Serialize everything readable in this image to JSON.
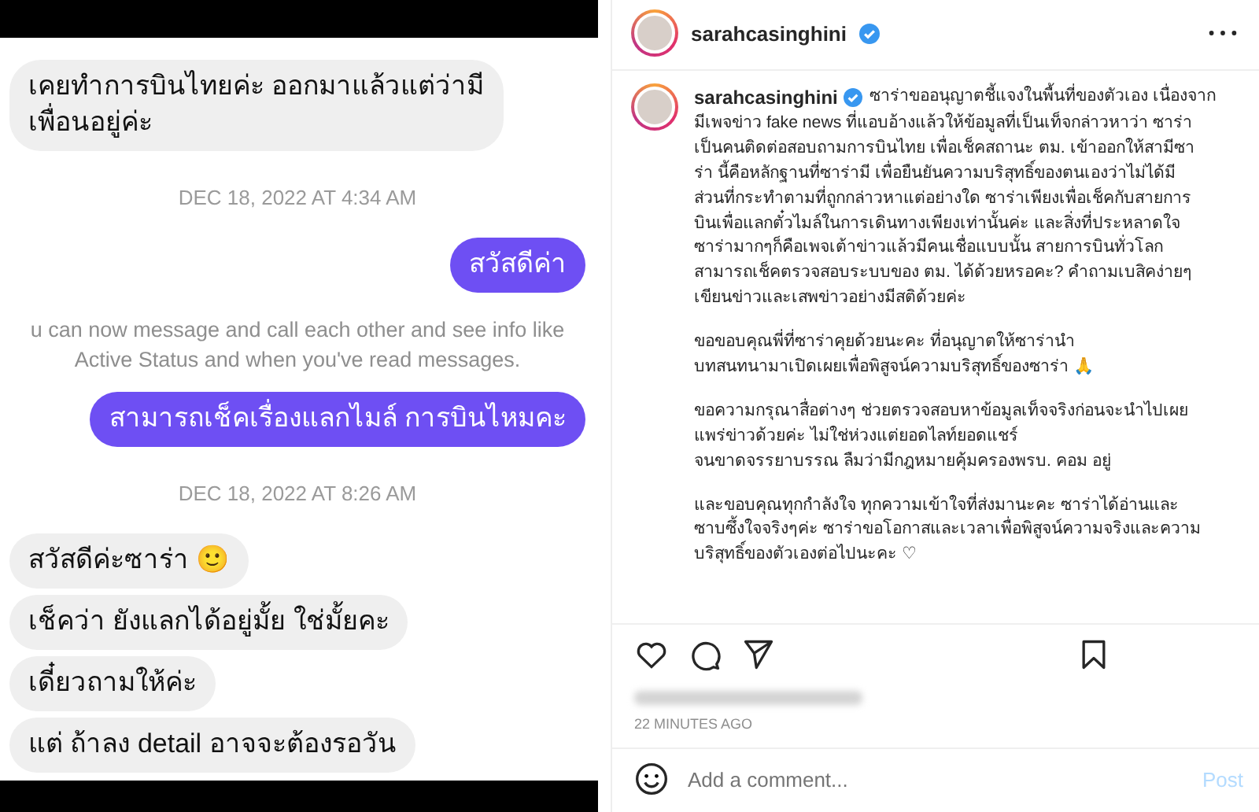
{
  "chat": {
    "items": [
      {
        "kind": "received",
        "text": "เคยทำการบินไทยค่ะ ออกมาแล้วแต่ว่ามี\nเพื่อนอยู่ค่ะ"
      },
      {
        "kind": "date",
        "text": "DEC 18, 2022 AT 4:34 AM"
      },
      {
        "kind": "sent",
        "text": "สวัสดีค่า"
      },
      {
        "kind": "notice",
        "text": "u can now message and call each other and see info like\nActive Status and when you've read messages."
      },
      {
        "kind": "sent",
        "text": "สามารถเช็คเรื่องแลกไมล์ การบินไหมคะ"
      },
      {
        "kind": "date",
        "text": "DEC 18, 2022 AT 8:26 AM"
      },
      {
        "kind": "received",
        "text": "สวัสดีค่ะซาร่า 🙂"
      },
      {
        "kind": "received",
        "text": "เช็คว่า ยังแลกได้อยู่มั้ย ใช่มั้ยคะ"
      },
      {
        "kind": "received",
        "text": "เดี๋ยวถามให้ค่ะ"
      },
      {
        "kind": "received",
        "text": "แต่ ถ้าลง detail อาจจะต้องรอวัน"
      }
    ]
  },
  "post": {
    "username": "sarahcasinghini",
    "caption": {
      "username": "sarahcasinghini",
      "intro": "ซาร่าขออนุญาตชี้แจงในพื้นที่ของตัวเอง เนื่องจาก",
      "paragraphs": [
        "มีเพจข่าว fake news ที่แอบอ้างแล้วให้ข้อมูลที่เป็นเท็จกล่าวหาว่า ซาร่า\nเป็นคนติดต่อสอบถามการบินไทย เพื่อเช็คสถานะ ตม. เข้าออกให้สามีซา\nร่า นี้คือหลักฐานที่ซาร่ามี เพื่อยืนยันความบริสุทธิ์ของตนเองว่าไม่ได้มี\nส่วนที่กระทำตามที่ถูกกล่าวหาแต่อย่างใด ซาร่าเพียงเพื่อเช็คกับสายการ\nบินเพื่อแลกตั๋วไมล์ในการเดินทางเพียงเท่านั้นค่ะ และสิ่งที่ประหลาดใจ\nซาร่ามากๆก็คือเพจเต้าข่าวแล้วมีคนเชื่อแบบนั้น สายการบินทั่วโลก\nสามารถเช็คตรวจสอบระบบของ ตม. ได้ด้วยหรอคะ? คำถามเบสิคง่ายๆ\nเขียนข่าวและเสพข่าวอย่างมีสติด้วยค่ะ",
        "ขอขอบคุณพี่ที่ซาร่าคุยด้วยนะคะ ที่อนุญาตให้ซาร่านำ\nบทสนทนามาเปิดเผยเพื่อพิสูจน์ความบริสุทธิ์ของซาร่า 🙏",
        "ขอความกรุณาสื่อต่างๆ ช่วยตรวจสอบหาข้อมูลเท็จจริงก่อนจะนำไปเผย\nแพร่ข่าวด้วยค่ะ ไม่ใช่ห่วงแต่ยอดไลท์ยอดแชร์\nจนขาดจรรยาบรรณ ลืมว่ามีกฎหมายคุ้มครองพรบ. คอม อยู่",
        "และขอบคุณทุกกำลังใจ ทุกความเข้าใจที่ส่งมานะคะ ซาร่าได้อ่านและ\nซาบซึ้งใจจริงๆค่ะ ซาร่าขอโอกาสและเวลาเพื่อพิสูจน์ความจริงและความ\nบริสุทธิ์ของตัวเองต่อไปนะคะ ♡"
      ]
    },
    "time": "22 MINUTES AGO",
    "comment": {
      "placeholder": "Add a comment...",
      "button": "Post"
    }
  }
}
